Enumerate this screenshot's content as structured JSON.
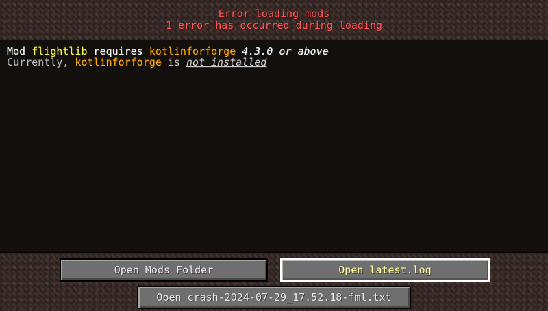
{
  "header": {
    "title": "Error loading mods",
    "subtitle": "1 error has occurred during loading"
  },
  "errors": [
    {
      "line1": {
        "prefix": "Mod ",
        "mod_name": "flightlib",
        "middle": " requires ",
        "dependency": "kotlinforforge",
        "space": " ",
        "version": "4.3.0 or above"
      },
      "line2": {
        "prefix": "Currently, ",
        "dependency": "kotlinforforge",
        "middle": " is ",
        "status": "not installed"
      }
    }
  ],
  "buttons": {
    "open_mods_folder": "Open Mods Folder",
    "open_latest_log": "Open latest.log",
    "open_crash_report": "Open crash-2024-07-29_17.52.18-fml.txt"
  },
  "colors": {
    "error_red": "#ff5555",
    "mod_yellow": "#ffff55",
    "dependency_orange": "#ffaa00",
    "button_gray": "#6f6f6f",
    "panel_dark": "#130f0d"
  }
}
